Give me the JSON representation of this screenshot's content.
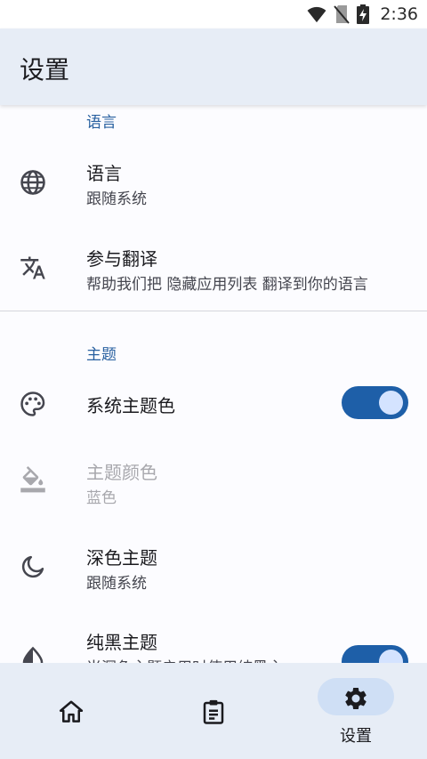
{
  "status_bar": {
    "time": "2:36",
    "icons": [
      "wifi-icon",
      "no-sim-icon",
      "battery-charging-icon"
    ]
  },
  "app_bar": {
    "title": "设置"
  },
  "sections": {
    "language": {
      "header": "语言",
      "items": {
        "language": {
          "icon": "globe-icon",
          "title": "语言",
          "subtitle": "跟随系统"
        },
        "translate": {
          "icon": "translate-icon",
          "title": "参与翻译",
          "subtitle": "帮助我们把 隐藏应用列表 翻译到你的语言"
        }
      }
    },
    "theme": {
      "header": "主题",
      "items": {
        "system_color": {
          "icon": "palette-icon",
          "title": "系统主题色",
          "switch_on": true
        },
        "theme_color": {
          "icon": "format-color-fill-icon",
          "title": "主题颜色",
          "subtitle": "蓝色",
          "enabled": false
        },
        "dark_theme": {
          "icon": "moon-icon",
          "title": "深色主题",
          "subtitle": "跟随系统"
        },
        "black_theme": {
          "icon": "contrast-icon",
          "title": "纯黑主题",
          "subtitle": "当深色主题启用时使用纯黑主",
          "switch_on": true
        }
      }
    }
  },
  "bottom_nav": {
    "items": [
      {
        "icon": "home-icon",
        "label": "",
        "active": false
      },
      {
        "icon": "clipboard-list-icon",
        "label": "",
        "active": false
      },
      {
        "icon": "gear-icon",
        "label": "设置",
        "active": true
      }
    ]
  },
  "colors": {
    "accent": "#1e5fa8",
    "section_header": "#2860a0",
    "app_bar_bg": "#e7edf6",
    "active_pill": "#cfdff5"
  }
}
